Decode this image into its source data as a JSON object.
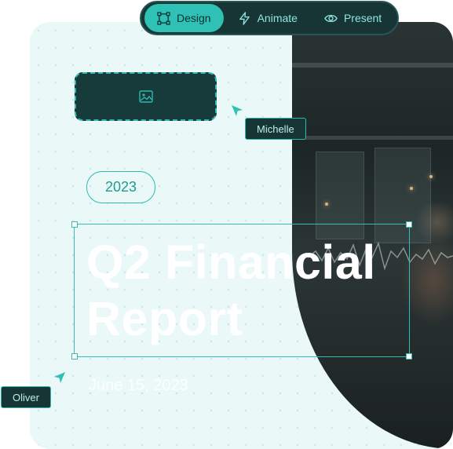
{
  "toolbar": {
    "modes": [
      {
        "label": "Design",
        "icon": "design-icon",
        "active": true
      },
      {
        "label": "Animate",
        "icon": "lightning-icon",
        "active": false
      },
      {
        "label": "Present",
        "icon": "eye-icon",
        "active": false
      }
    ]
  },
  "slide": {
    "image_placeholder_icon": "image-icon",
    "year": "2023",
    "title_line1": "Q2 Financial",
    "title_line2": "Report",
    "date": "June 15, 2023"
  },
  "collaborators": [
    {
      "name": "Michelle"
    },
    {
      "name": "Oliver"
    }
  ],
  "colors": {
    "accent": "#2fc0b6",
    "dark": "#173535",
    "canvas": "#eaf8f8"
  }
}
